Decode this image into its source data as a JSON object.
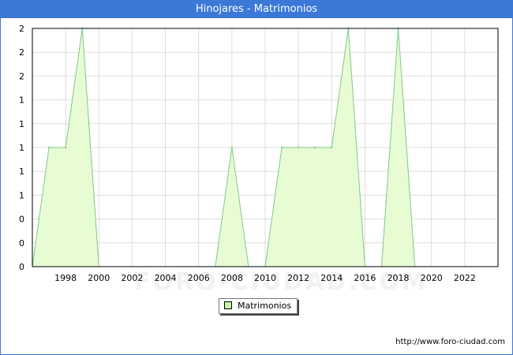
{
  "title": "Hinojares - Matrimonios",
  "source_url": "http://www.foro-ciudad.com",
  "watermark": "FORO-CIUDAD.COM",
  "colors": {
    "header_bg": "#3c78d8",
    "area_fill": "#e8fcd4",
    "area_line": "#7dc98a",
    "grid": "#dddddd",
    "swatch_fill": "#c7f4a4"
  },
  "chart_data": {
    "type": "area",
    "title": "Hinojares - Matrimonios",
    "xlabel": "",
    "ylabel": "",
    "x": [
      1996,
      1997,
      1998,
      1999,
      2000,
      2001,
      2002,
      2003,
      2004,
      2005,
      2006,
      2007,
      2008,
      2009,
      2010,
      2011,
      2012,
      2013,
      2014,
      2015,
      2016,
      2017,
      2018,
      2019,
      2020,
      2021,
      2022,
      2023
    ],
    "series": [
      {
        "name": "Matrimonios",
        "values": [
          0,
          1,
          1,
          2,
          0,
          0,
          0,
          0,
          0,
          0,
          0,
          0,
          1,
          0,
          0,
          1,
          1,
          1,
          1,
          2,
          0,
          0,
          2,
          0,
          0,
          0,
          0,
          0
        ]
      }
    ],
    "xlim": [
      1996,
      2024
    ],
    "ylim": [
      0,
      2
    ],
    "x_ticks": [
      "1998",
      "2000",
      "2002",
      "2004",
      "2006",
      "2008",
      "2010",
      "2012",
      "2014",
      "2016",
      "2018",
      "2020",
      "2022"
    ],
    "y_tick_labels": [
      "0",
      "0",
      "0",
      "1",
      "1",
      "1",
      "1",
      "1",
      "2",
      "2",
      "2"
    ],
    "grid": true,
    "legend_position": "bottom-center"
  }
}
